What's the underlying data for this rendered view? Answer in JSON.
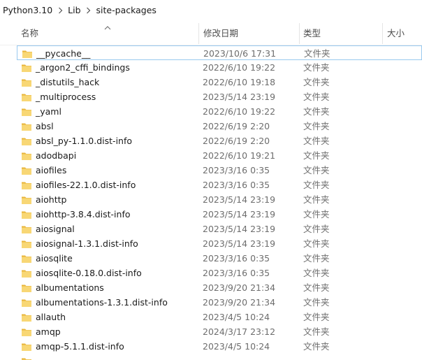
{
  "breadcrumb": {
    "items": [
      "Python3.10",
      "Lib",
      "site-packages"
    ]
  },
  "columns": {
    "name": "名称",
    "date": "修改日期",
    "type": "类型",
    "size": "大小"
  },
  "rows": [
    {
      "name": "__pycache__",
      "date": "2023/10/6 17:31",
      "type": "文件夹"
    },
    {
      "name": "_argon2_cffi_bindings",
      "date": "2022/6/10 19:22",
      "type": "文件夹"
    },
    {
      "name": "_distutils_hack",
      "date": "2022/6/10 19:18",
      "type": "文件夹"
    },
    {
      "name": "_multiprocess",
      "date": "2023/5/14 23:19",
      "type": "文件夹"
    },
    {
      "name": "_yaml",
      "date": "2022/6/10 19:22",
      "type": "文件夹"
    },
    {
      "name": "absl",
      "date": "2022/6/19 2:20",
      "type": "文件夹"
    },
    {
      "name": "absl_py-1.1.0.dist-info",
      "date": "2022/6/19 2:20",
      "type": "文件夹"
    },
    {
      "name": "adodbapi",
      "date": "2022/6/10 19:21",
      "type": "文件夹"
    },
    {
      "name": "aiofiles",
      "date": "2023/3/16 0:35",
      "type": "文件夹"
    },
    {
      "name": "aiofiles-22.1.0.dist-info",
      "date": "2023/3/16 0:35",
      "type": "文件夹"
    },
    {
      "name": "aiohttp",
      "date": "2023/5/14 23:19",
      "type": "文件夹"
    },
    {
      "name": "aiohttp-3.8.4.dist-info",
      "date": "2023/5/14 23:19",
      "type": "文件夹"
    },
    {
      "name": "aiosignal",
      "date": "2023/5/14 23:19",
      "type": "文件夹"
    },
    {
      "name": "aiosignal-1.3.1.dist-info",
      "date": "2023/5/14 23:19",
      "type": "文件夹"
    },
    {
      "name": "aiosqlite",
      "date": "2023/3/16 0:35",
      "type": "文件夹"
    },
    {
      "name": "aiosqlite-0.18.0.dist-info",
      "date": "2023/3/16 0:35",
      "type": "文件夹"
    },
    {
      "name": "albumentations",
      "date": "2023/9/20 21:34",
      "type": "文件夹"
    },
    {
      "name": "albumentations-1.3.1.dist-info",
      "date": "2023/9/20 21:34",
      "type": "文件夹"
    },
    {
      "name": "allauth",
      "date": "2023/4/5 10:24",
      "type": "文件夹"
    },
    {
      "name": "amqp",
      "date": "2024/3/17 23:12",
      "type": "文件夹"
    },
    {
      "name": "amqp-5.1.1.dist-info",
      "date": "2023/4/5 10:24",
      "type": "文件夹"
    },
    {
      "name": "",
      "date": "",
      "type": ""
    }
  ]
}
